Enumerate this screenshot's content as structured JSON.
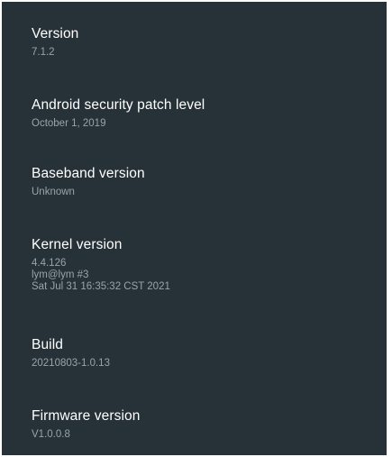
{
  "settings": {
    "items": [
      {
        "title": "Version",
        "summary": [
          "7.1.2"
        ]
      },
      {
        "title": "Android security patch level",
        "summary": [
          "October 1, 2019"
        ]
      },
      {
        "title": "Baseband version",
        "summary": [
          "Unknown"
        ]
      },
      {
        "title": "Kernel version",
        "summary": [
          "4.4.126",
          "lym@lym #3",
          "Sat Jul 31 16:35:32 CST 2021"
        ]
      },
      {
        "title": "Build",
        "summary": [
          "20210803-1.0.13"
        ]
      },
      {
        "title": "Firmware version",
        "summary": [
          "V1.0.0.8"
        ]
      }
    ]
  },
  "colors": {
    "background": "#263238",
    "title": "#ffffff",
    "summary": "#9aa3a8"
  }
}
